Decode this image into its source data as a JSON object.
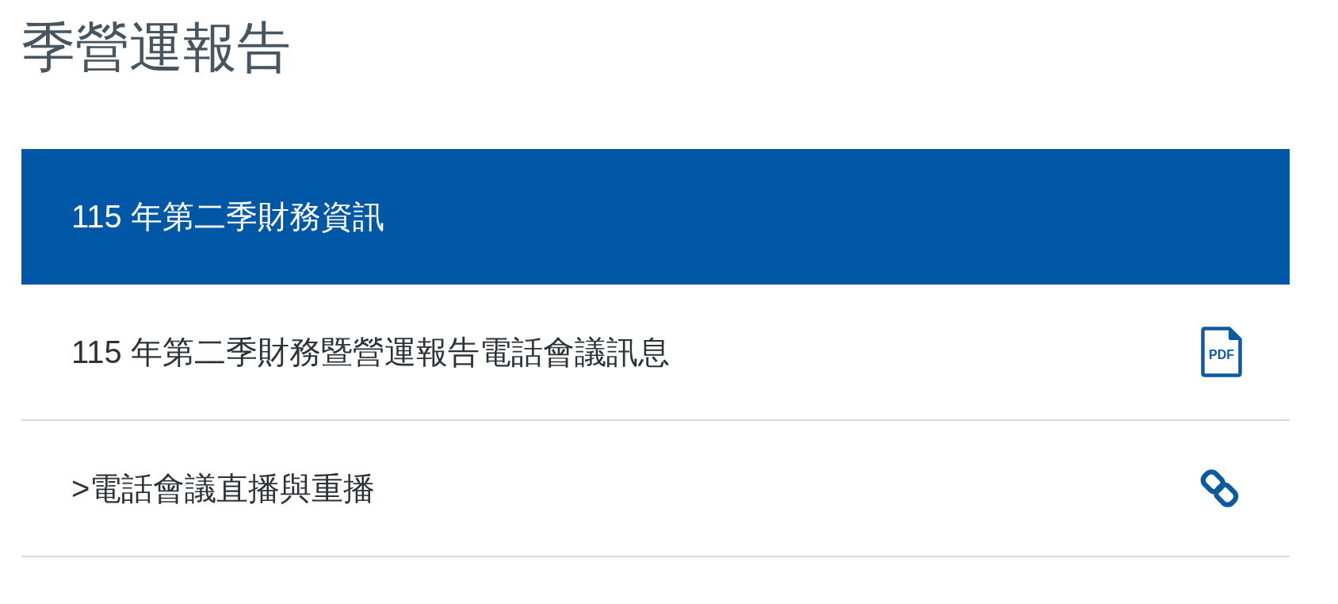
{
  "page_title": "季營運報告",
  "sections": [
    {
      "title": "115 年第二季財務資訊",
      "expanded": true,
      "items": [
        {
          "label": "115 年第二季財務暨營運報告電話會議訊息",
          "kind": "pdf",
          "icon_label": "PDF"
        },
        {
          "label": ">電話會議直播與重播",
          "kind": "link"
        }
      ]
    }
  ]
}
